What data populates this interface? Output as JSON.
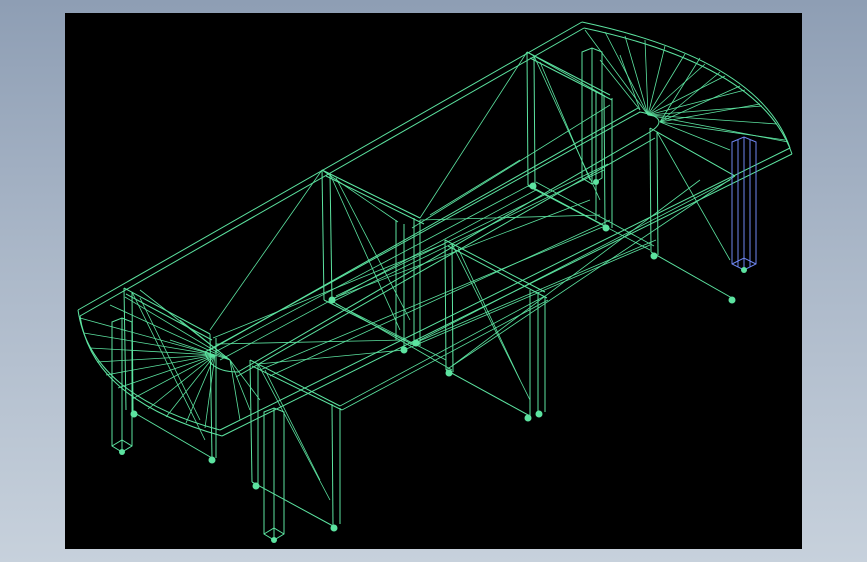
{
  "colors": {
    "page_background": "#9aa9bd",
    "viewport_background": "#000000",
    "wireframe_primary": "#5ce3a0",
    "wireframe_selected": "#6e86f0"
  },
  "icons": {
    "selected_leg": "square-leg-column"
  }
}
